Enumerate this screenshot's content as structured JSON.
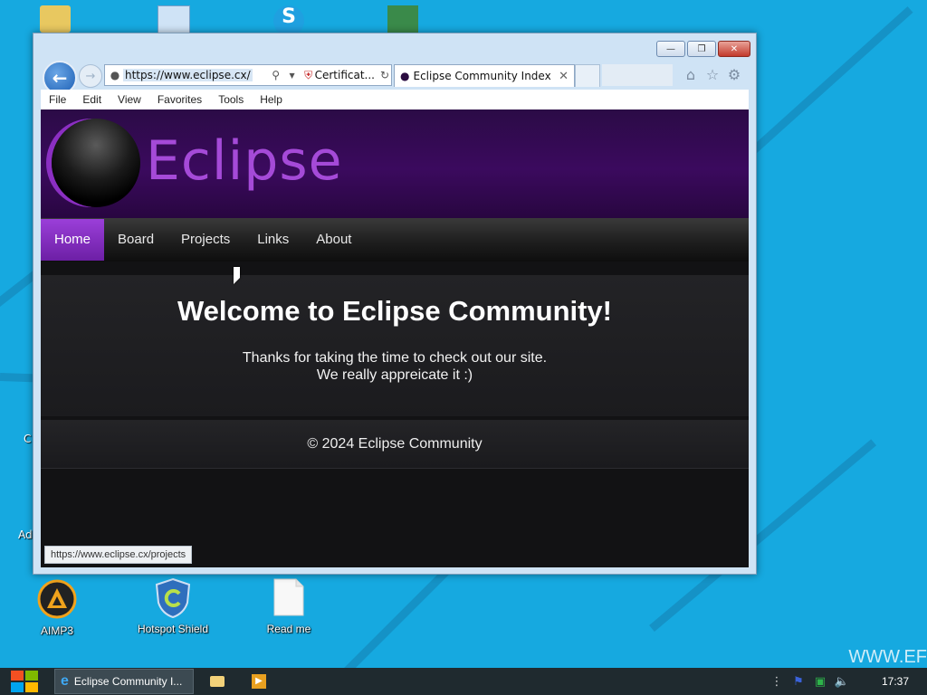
{
  "browser": {
    "address_url": "https://www.eclipse.cx/",
    "cert_text": "Certificat...",
    "tab_title": "Eclipse Community Index",
    "menu": [
      "File",
      "Edit",
      "View",
      "Favorites",
      "Tools",
      "Help"
    ],
    "status_url": "https://www.eclipse.cx/projects"
  },
  "site": {
    "logo_text": "Eclipse",
    "nav": [
      "Home",
      "Board",
      "Projects",
      "Links",
      "About"
    ],
    "active_nav": "Home",
    "heading": "Welcome to Eclipse Community!",
    "subtext_line1": "Thanks for taking the time to check out our site.",
    "subtext_line2": "We really appreicate it :)",
    "footer": "© 2024 Eclipse Community"
  },
  "desktop": {
    "icons": [
      "AIMP3",
      "Hotspot Shield",
      "Read me"
    ],
    "side_fragments": [
      "C",
      "Ad"
    ],
    "watermark": "WWW.EF"
  },
  "taskbar": {
    "active_title": "Eclipse Community I...",
    "clock": "17:37"
  },
  "colors": {
    "desktop_bg": "#16a9e0",
    "brand_purple": "#a54ad8",
    "nav_active": "#8a35c8"
  }
}
